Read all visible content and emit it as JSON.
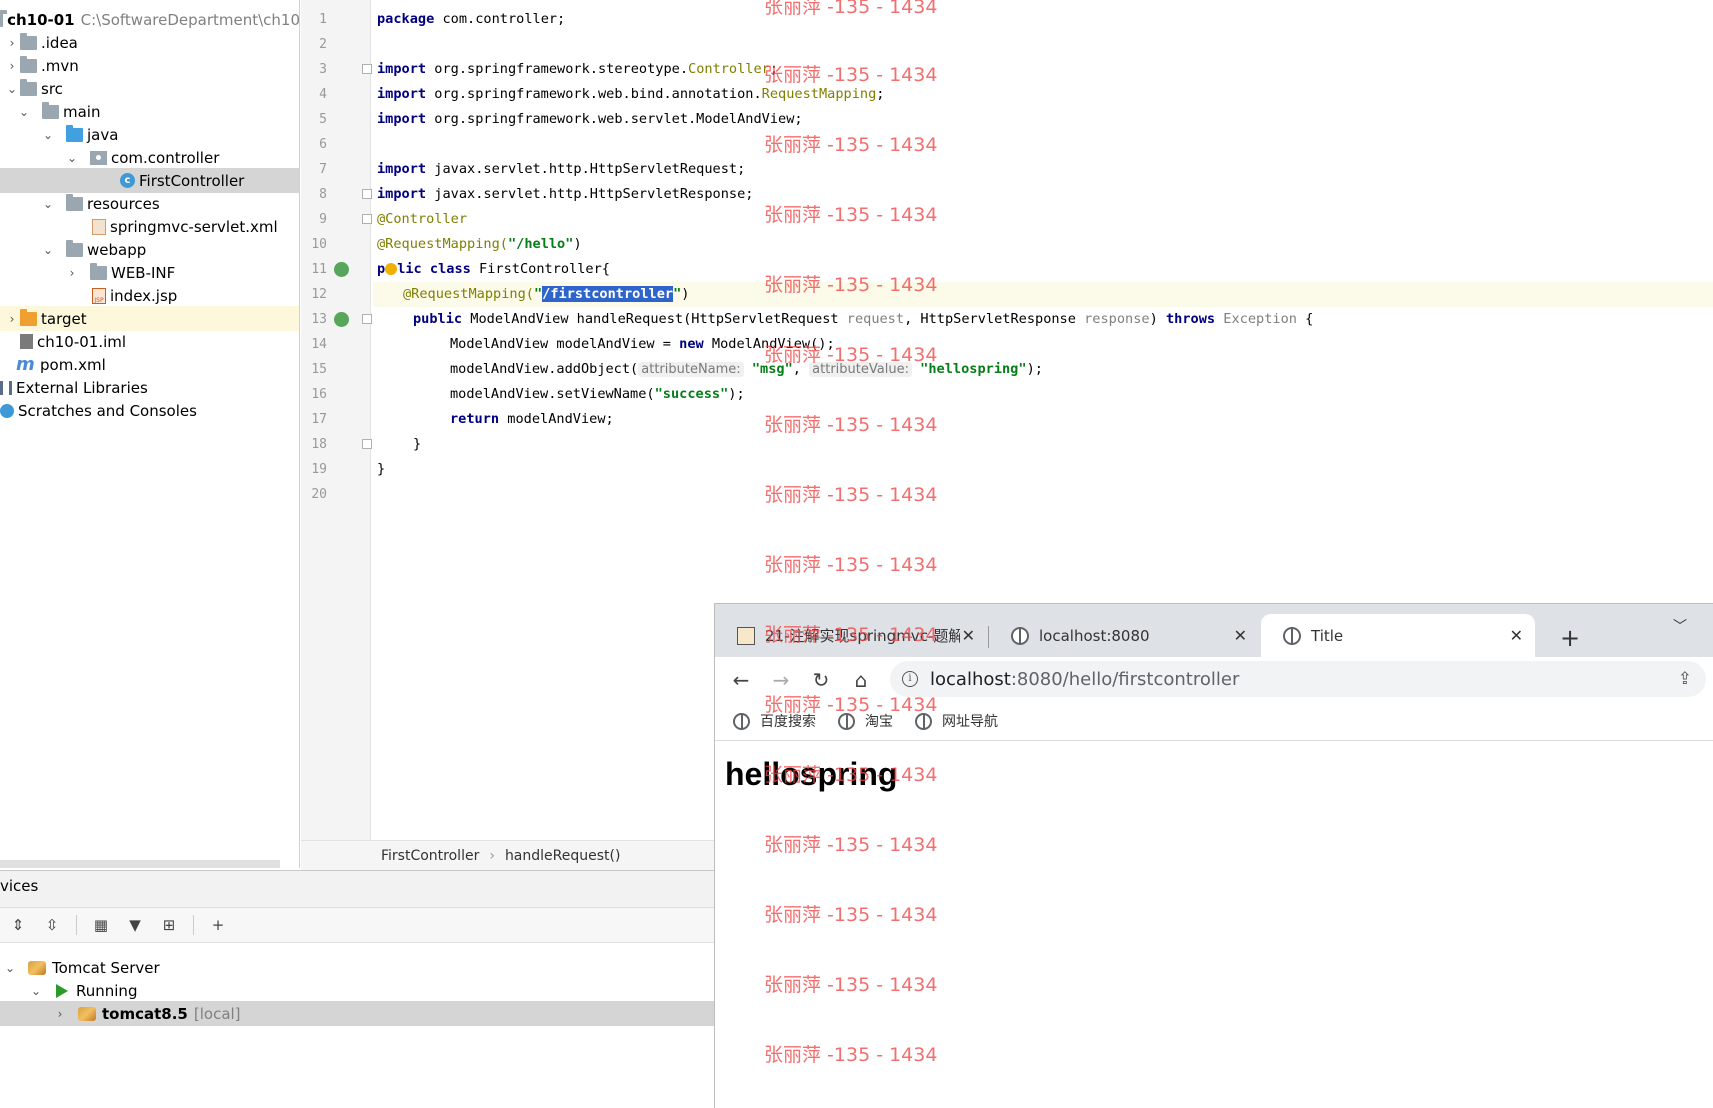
{
  "project": {
    "root_name": "ch10-01",
    "root_path": "C:\\SoftwareDepartment\\ch10",
    "items": {
      "idea": ".idea",
      "mvn": ".mvn",
      "src": "src",
      "main": "main",
      "java": "java",
      "pkg": "com.controller",
      "cls": "FirstController",
      "resources": "resources",
      "xml": "springmvc-servlet.xml",
      "webapp": "webapp",
      "webinf": "WEB-INF",
      "jsp": "index.jsp",
      "target": "target",
      "iml": "ch10-01.iml",
      "pom": "pom.xml",
      "libs": "External Libraries",
      "scratches": "Scratches and Consoles"
    }
  },
  "editor": {
    "line_numbers": [
      "1",
      "2",
      "3",
      "4",
      "5",
      "6",
      "7",
      "8",
      "9",
      "10",
      "11",
      "12",
      "13",
      "14",
      "15",
      "16",
      "17",
      "18",
      "19",
      "20"
    ],
    "code": {
      "l1_kw": "package",
      "l1_rest": " com.controller;",
      "l3_kw": "import",
      "l3_pre": " org.springframework.stereotype.",
      "l3_an": "Controller",
      "l3_end": ";",
      "l4_kw": "import",
      "l4_pre": " org.springframework.web.bind.annotation.",
      "l4_an": "RequestMapping",
      "l4_end": ";",
      "l5_kw": "import",
      "l5_rest": " org.springframework.web.servlet.ModelAndView;",
      "l7_kw": "import",
      "l7_rest": " javax.servlet.http.HttpServletRequest;",
      "l8_kw": "import",
      "l8_rest": " javax.servlet.http.HttpServletResponse;",
      "l9_an": "@Controller",
      "l10_an": "@RequestMapping(",
      "l10_st": "\"/hello\"",
      "l10_end": ")",
      "l11_kw_a": "p",
      "l11_kw_b": "lic",
      "l11_kw2": " class",
      "l11_rest": " FirstController{",
      "l12_an": "@RequestMapping(",
      "l12_q1": "\"",
      "l12_sel": "/firstcontroller",
      "l12_q2": "\"",
      "l12_end": ")",
      "l13_kw": "public",
      "l13_a": " ModelAndView handleRequest(HttpServletRequest ",
      "l13_p1": "request",
      "l13_b": ", HttpServletResponse ",
      "l13_p2": "response",
      "l13_c": ") ",
      "l13_kw2": "throws",
      "l13_d": " ",
      "l13_ex": "Exception",
      "l13_e": " {",
      "l14_a": "ModelAndView modelAndView = ",
      "l14_kw": "new",
      "l14_b": " ModelAndView();",
      "l15_a": "modelAndView.addObject(",
      "l15_h1": "attributeName:",
      "l15_s1": "\"msg\"",
      "l15_b": ", ",
      "l15_h2": "attributeValue:",
      "l15_s2": "\"hellospring\"",
      "l15_c": ");",
      "l16_a": "modelAndView.setViewName(",
      "l16_s": "\"success\"",
      "l16_b": ");",
      "l17_kw": "return",
      "l17_rest": " modelAndView;",
      "l18": "}",
      "l19": "}"
    },
    "breadcrumb": [
      "FirstController",
      "handleRequest()"
    ]
  },
  "services": {
    "title": "vices",
    "tomcat_server": "Tomcat Server",
    "running": "Running",
    "instance": "tomcat8.5",
    "instance_tag": "[local]"
  },
  "browser": {
    "tabs": [
      {
        "title": "21-注解实现springmvc-题解"
      },
      {
        "title": "localhost:8080"
      },
      {
        "title": "Title"
      }
    ],
    "url_host": "localhost",
    "url_rest": ":8080/hello/firstcontroller",
    "bookmarks": [
      "百度搜索",
      "淘宝",
      "网址导航"
    ],
    "page_heading": "hellospring"
  },
  "watermark": "张丽萍 -135 - 1434"
}
